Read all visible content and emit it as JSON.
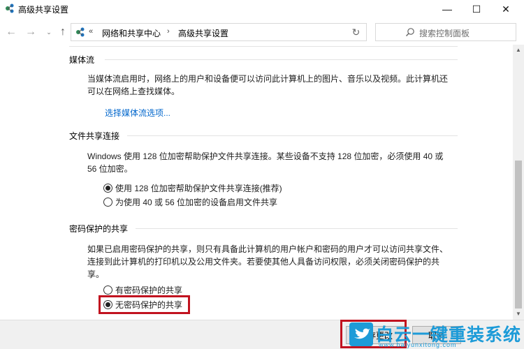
{
  "window": {
    "title": "高级共享设置",
    "minimize_icon": "—",
    "maximize_icon": "☐",
    "close_icon": "✕"
  },
  "nav": {
    "back_icon": "←",
    "forward_icon": "→",
    "recent_icon": "⌄",
    "up_icon": "↑",
    "overflow": "«",
    "crumbs": [
      "网络和共享中心",
      "高级共享设置"
    ],
    "crumb_sep": "›",
    "dropdown_icon": "⌄",
    "refresh_icon": "↻",
    "search_placeholder": "搜索控制面板"
  },
  "sections": {
    "media": {
      "header": "媒体流",
      "desc_line1": "当媒体流启用时，网络上的用户和设备便可以访问此计算机上的图片、音乐以及视频。此计算机还",
      "desc_line2": "可以在网络上查找媒体。",
      "link": "选择媒体流选项..."
    },
    "file_sharing": {
      "header": "文件共享连接",
      "desc_line1": "Windows 使用 128 位加密帮助保护文件共享连接。某些设备不支持 128 位加密，必须使用 40 或",
      "desc_line2": "56 位加密。",
      "options": [
        {
          "label": "使用 128 位加密帮助保护文件共享连接(推荐)",
          "selected": true
        },
        {
          "label": "为使用 40 或 56 位加密的设备启用文件共享",
          "selected": false
        }
      ]
    },
    "password": {
      "header": "密码保护的共享",
      "desc_line1": "如果已启用密码保护的共享，则只有具备此计算机的用户帐户和密码的用户才可以访问共享文件、",
      "desc_line2": "连接到此计算机的打印机以及公用文件夹。若要使其他人具备访问权限，必须关闭密码保护的共",
      "desc_line3": "享。",
      "options": [
        {
          "label": "有密码保护的共享",
          "selected": false
        },
        {
          "label": "无密码保护的共享",
          "selected": true
        }
      ]
    }
  },
  "buttons": {
    "save": "保存更改",
    "cancel": "取消"
  },
  "watermark": {
    "title": "白云一键重装系统",
    "url": "www.baiyunxitong.com"
  },
  "colors": {
    "link": "#0066cc",
    "highlight": "#c1121f",
    "watermark": "#1d9bd8"
  }
}
